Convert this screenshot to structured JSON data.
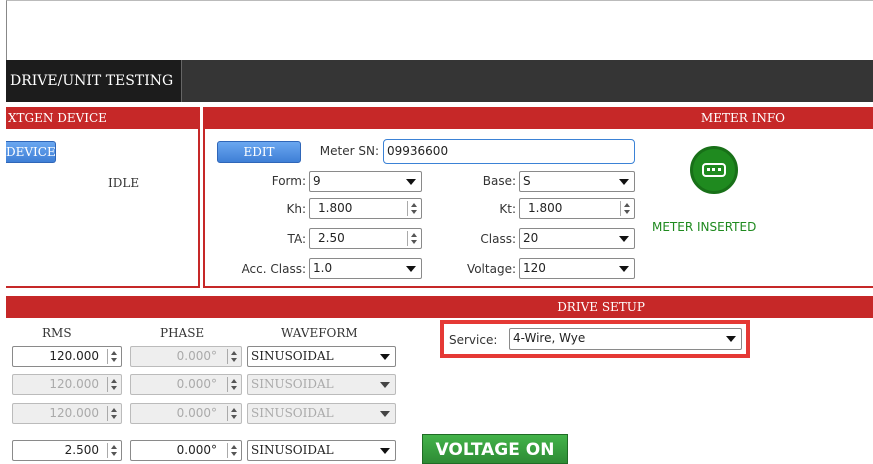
{
  "tab": {
    "label": "DRIVE/UNIT TESTING"
  },
  "left_panel": {
    "title": "XTGEN DEVICE",
    "button_label": "DEVICE",
    "status": "IDLE"
  },
  "meter_info": {
    "title": "METER INFO",
    "edit_label": "EDIT",
    "meter_sn_label": "Meter SN:",
    "meter_sn_value": "09936600",
    "form_label": "Form:",
    "form_value": "9",
    "base_label": "Base:",
    "base_value": "S",
    "kh_label": "Kh:",
    "kh_value": "1.800",
    "kt_label": "Kt:",
    "kt_value": "1.800",
    "ta_label": "TA:",
    "ta_value": "2.50",
    "class_label": "Class:",
    "class_value": "20",
    "acc_class_label": "Acc. Class:",
    "acc_class_value": "1.0",
    "voltage_label": "Voltage:",
    "voltage_value": "120",
    "status_text": "METER INSERTED",
    "status_icon": "meter-icon",
    "status_color": "#1f8a1f"
  },
  "drive_setup": {
    "title": "DRIVE SETUP",
    "columns": {
      "rms": "RMS",
      "phase": "PHASE",
      "waveform": "WAVEFORM"
    },
    "rows": [
      {
        "rms": "120.000",
        "phase": "0.000°",
        "waveform": "SINUSOIDAL",
        "enabled": true
      },
      {
        "rms": "120.000",
        "phase": "0.000°",
        "waveform": "SINUSOIDAL",
        "enabled": false
      },
      {
        "rms": "120.000",
        "phase": "0.000°",
        "waveform": "SINUSOIDAL",
        "enabled": false
      },
      {
        "rms": "2.500",
        "phase": "0.000°",
        "waveform": "SINUSOIDAL",
        "enabled": true
      }
    ],
    "service_label": "Service:",
    "service_value": "4-Wire, Wye",
    "voltage_button": "VOLTAGE ON"
  },
  "colors": {
    "accent_red": "#c62828",
    "highlight_red": "#e53935",
    "button_blue": "#3f7fd6",
    "ok_green": "#2e8b35"
  }
}
